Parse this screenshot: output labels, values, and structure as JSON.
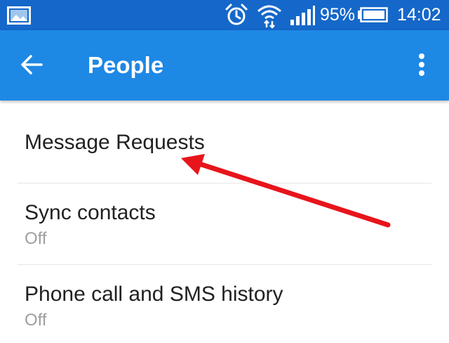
{
  "status_bar": {
    "battery_percent": "95%",
    "time": "14:02",
    "icons": [
      "gallery-icon",
      "alarm-icon",
      "wifi-icon",
      "signal-icon",
      "battery-icon"
    ]
  },
  "app_bar": {
    "title": "People",
    "back_icon": "arrow-left-icon",
    "menu_icon": "more-vert-icon"
  },
  "settings": {
    "items": [
      {
        "label": "Message Requests",
        "value": ""
      },
      {
        "label": "Sync contacts",
        "value": "Off"
      },
      {
        "label": "Phone call and SMS history",
        "value": "Off"
      }
    ]
  },
  "colors": {
    "status_bar": "#1568c9",
    "app_bar": "#1e88e5",
    "primary_text": "#212121",
    "secondary_text": "#9e9e9e",
    "annotation_arrow": "#e8141b"
  }
}
